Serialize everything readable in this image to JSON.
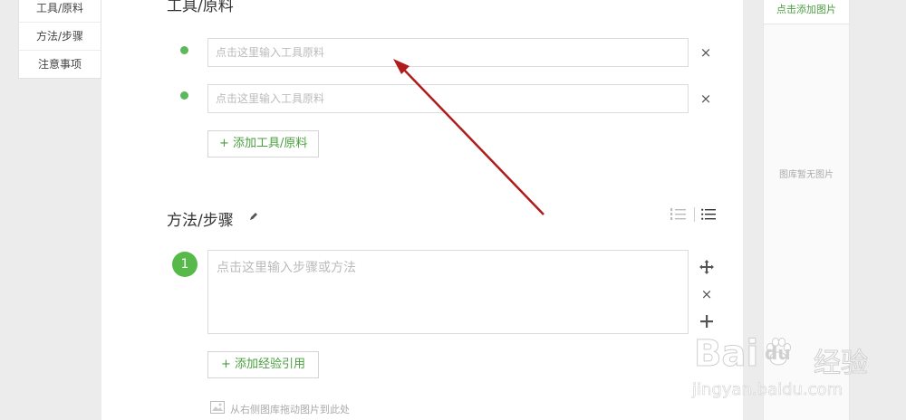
{
  "sidebar": {
    "items": [
      {
        "label": "工具/原料"
      },
      {
        "label": "方法/步骤"
      },
      {
        "label": "注意事项"
      }
    ]
  },
  "tools_section": {
    "title": "工具/原料",
    "inputs": [
      {
        "placeholder": "点击这里输入工具原料"
      },
      {
        "placeholder": "点击这里输入工具原料"
      }
    ],
    "remove_icon": "×",
    "add_button_label": "+ 添加工具/原料"
  },
  "steps_section": {
    "title": "方法/步骤",
    "edit_icon": "pencil-icon",
    "steps": [
      {
        "number": "1",
        "placeholder": "点击这里输入步骤或方法"
      }
    ],
    "add_reference_label": "+ 添加经验引用",
    "drag_hint": "从右侧图库拖动图片到此处"
  },
  "image_panel": {
    "add_label": "点击添加图片",
    "empty_text": "图库暂无图片"
  },
  "watermark": {
    "brand": "Bai",
    "brand_du": "du",
    "brand_cn": "经验",
    "url": "jingyan.baidu.com"
  },
  "colors": {
    "accent_green": "#56b949",
    "arrow_red": "#b01c1c"
  }
}
